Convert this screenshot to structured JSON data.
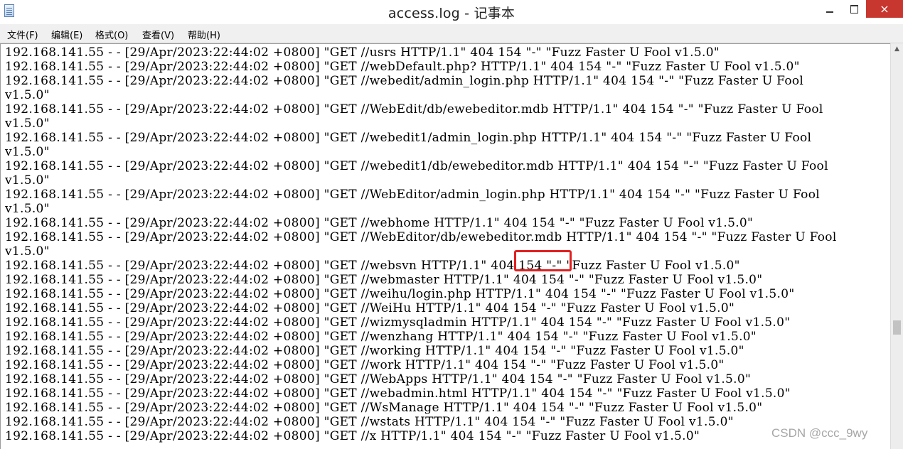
{
  "window": {
    "title": "access.log - 记事本",
    "app_icon": "notepad-icon",
    "controls": {
      "minimize": "minimize-icon",
      "maximize": "maximize-icon",
      "close": "×"
    }
  },
  "menu": {
    "items": [
      "文件(F)",
      "编辑(E)",
      "格式(O)",
      "查看(V)",
      "帮助(H)"
    ]
  },
  "editor": {
    "lines": [
      "192.168.141.55 - - [29/Apr/2023:22:44:02 +0800] \"GET //usrs HTTP/1.1\" 404 154 \"-\" \"Fuzz Faster U Fool v1.5.0\"",
      "192.168.141.55 - - [29/Apr/2023:22:44:02 +0800] \"GET //webDefault.php? HTTP/1.1\" 404 154 \"-\" \"Fuzz Faster U Fool v1.5.0\"",
      "192.168.141.55 - - [29/Apr/2023:22:44:02 +0800] \"GET //webedit/admin_login.php HTTP/1.1\" 404 154 \"-\" \"Fuzz Faster U Fool",
      "v1.5.0\"",
      "192.168.141.55 - - [29/Apr/2023:22:44:02 +0800] \"GET //WebEdit/db/ewebeditor.mdb HTTP/1.1\" 404 154 \"-\" \"Fuzz Faster U Fool",
      "v1.5.0\"",
      "192.168.141.55 - - [29/Apr/2023:22:44:02 +0800] \"GET //webedit1/admin_login.php HTTP/1.1\" 404 154 \"-\" \"Fuzz Faster U Fool",
      "v1.5.0\"",
      "192.168.141.55 - - [29/Apr/2023:22:44:02 +0800] \"GET //webedit1/db/ewebeditor.mdb HTTP/1.1\" 404 154 \"-\" \"Fuzz Faster U Fool",
      "v1.5.0\"",
      "192.168.141.55 - - [29/Apr/2023:22:44:02 +0800] \"GET //WebEditor/admin_login.php HTTP/1.1\" 404 154 \"-\" \"Fuzz Faster U Fool",
      "v1.5.0\"",
      "192.168.141.55 - - [29/Apr/2023:22:44:02 +0800] \"GET //webhome HTTP/1.1\" 404 154 \"-\" \"Fuzz Faster U Fool v1.5.0\"",
      "192.168.141.55 - - [29/Apr/2023:22:44:02 +0800] \"GET //WebEditor/db/ewebeditor.mdb HTTP/1.1\" 404 154 \"-\" \"Fuzz Faster U Fool",
      "v1.5.0\"",
      "192.168.141.55 - - [29/Apr/2023:22:44:02 +0800] \"GET //websvn HTTP/1.1\" 404 154 \"-\" \"Fuzz Faster U Fool v1.5.0\"",
      "192.168.141.55 - - [29/Apr/2023:22:44:02 +0800] \"GET //webmaster HTTP/1.1\" 404 154 \"-\" \"Fuzz Faster U Fool v1.5.0\"",
      "192.168.141.55 - - [29/Apr/2023:22:44:02 +0800] \"GET //weihu/login.php HTTP/1.1\" 404 154 \"-\" \"Fuzz Faster U Fool v1.5.0\"",
      "192.168.141.55 - - [29/Apr/2023:22:44:02 +0800] \"GET //WeiHu HTTP/1.1\" 404 154 \"-\" \"Fuzz Faster U Fool v1.5.0\"",
      "192.168.141.55 - - [29/Apr/2023:22:44:02 +0800] \"GET //wizmysqladmin HTTP/1.1\" 404 154 \"-\" \"Fuzz Faster U Fool v1.5.0\"",
      "192.168.141.55 - - [29/Apr/2023:22:44:02 +0800] \"GET //wenzhang HTTP/1.1\" 404 154 \"-\" \"Fuzz Faster U Fool v1.5.0\"",
      "192.168.141.55 - - [29/Apr/2023:22:44:02 +0800] \"GET //working HTTP/1.1\" 404 154 \"-\" \"Fuzz Faster U Fool v1.5.0\"",
      "192.168.141.55 - - [29/Apr/2023:22:44:02 +0800] \"GET //work HTTP/1.1\" 404 154 \"-\" \"Fuzz Faster U Fool v1.5.0\"",
      "192.168.141.55 - - [29/Apr/2023:22:44:02 +0800] \"GET //WebApps HTTP/1.1\" 404 154 \"-\" \"Fuzz Faster U Fool v1.5.0\"",
      "192.168.141.55 - - [29/Apr/2023:22:44:02 +0800] \"GET //webadmin.html HTTP/1.1\" 404 154 \"-\" \"Fuzz Faster U Fool v1.5.0\"",
      "192.168.141.55 - - [29/Apr/2023:22:44:02 +0800] \"GET //WsManage HTTP/1.1\" 404 154 \"-\" \"Fuzz Faster U Fool v1.5.0\"",
      "192.168.141.55 - - [29/Apr/2023:22:44:02 +0800] \"GET //wstats HTTP/1.1\" 404 154 \"-\" \"Fuzz Faster U Fool v1.5.0\"",
      "192.168.141.55 - - [29/Apr/2023:22:44:02 +0800] \"GET //x HTTP/1.1\" 404 154 \"-\" \"Fuzz Faster U Fool v1.5.0\""
    ]
  },
  "annotation": {
    "color": "#e02020"
  },
  "watermark": "CSDN @ccc_9wy",
  "colors": {
    "close_button": "#c7372f",
    "menubar": "#f0f0f0"
  }
}
